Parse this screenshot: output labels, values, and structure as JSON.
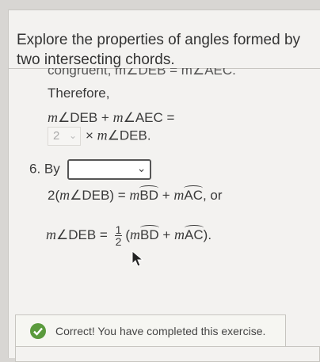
{
  "title": "Explore the properties of angles formed by two intersecting chords.",
  "cut_line": "congruent, m∠DEB = m∠AEC.",
  "therefore": "Therefore,",
  "sum_line": {
    "m1": "m",
    "angle1": "∠DEB",
    "plus": " + ",
    "m2": "m",
    "angle2": "∠AEC",
    "eq": " ="
  },
  "multiplier_select": {
    "value": "2"
  },
  "times_line": {
    "times": "× ",
    "m": "m",
    "angle": "∠DEB."
  },
  "step6": {
    "number": "6.",
    "by": "By",
    "select_value": ""
  },
  "eq1": {
    "pre": "2(",
    "m1": "m",
    "angle": "∠DEB) = ",
    "m2": "m",
    "arc1": "BD",
    "plus": " + ",
    "m3": "m",
    "arc2": "AC",
    "post": ", or"
  },
  "eq2": {
    "m1": "m",
    "angle": "∠DEB = ",
    "num": "1",
    "den": "2",
    "open": "(",
    "m2": "m",
    "arc1": "BD",
    "plus": " + ",
    "m3": "m",
    "arc2": "AC",
    "close": ")."
  },
  "feedback": {
    "message": "Correct! You have completed this exercise."
  },
  "colors": {
    "success": "#5a9a3c",
    "panel": "#f3f2f0"
  }
}
